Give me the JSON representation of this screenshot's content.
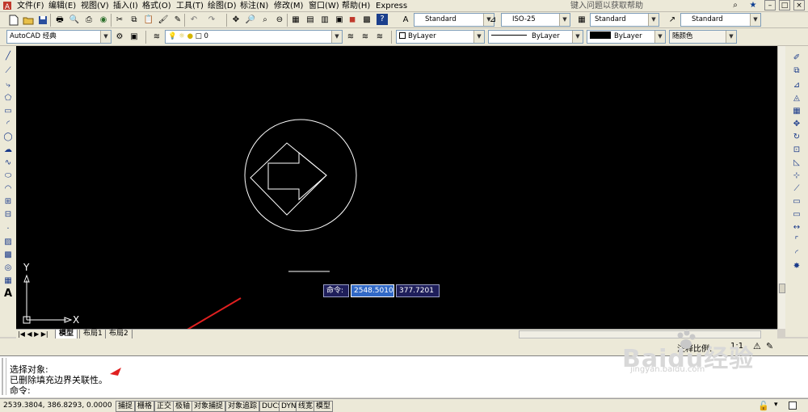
{
  "menubar": {
    "items": [
      "文件(F)",
      "编辑(E)",
      "视图(V)",
      "插入(I)",
      "格式(O)",
      "工具(T)",
      "绘图(D)",
      "标注(N)",
      "修改(M)",
      "窗口(W)",
      "帮助(H)",
      "Express"
    ],
    "help_search_placeholder": "键入问题以获取帮助"
  },
  "styles_toolbar": {
    "text_style": "Standard",
    "dim_style": "ISO-25",
    "table_style": "Standard",
    "mleader_style": "Standard"
  },
  "workspace": {
    "name": "AutoCAD 经典"
  },
  "layers": {
    "current_layer": "0"
  },
  "properties": {
    "color": "ByLayer",
    "linetype": "ByLayer",
    "lineweight": "ByLayer",
    "plot_style": "随颜色"
  },
  "canvas": {
    "ucs_y_label": "Y",
    "ucs_x_label": "X"
  },
  "dynamic_input": {
    "prompt": "命令:",
    "x_value": "2548.5010",
    "y_value": "377.7201"
  },
  "layout_tabs": [
    "模型",
    "布局1",
    "布局2"
  ],
  "annotation_scale": {
    "label": "注释比例:",
    "value": "1:1"
  },
  "command_history": [
    "选择对象:",
    "已删除填充边界关联性。",
    "命令:"
  ],
  "status": {
    "coordinates": "2539.3804, 386.8293, 0.0000",
    "toggles": [
      "捕捉",
      "栅格",
      "正交",
      "极轴",
      "对象捕捉",
      "对象追踪",
      "DUCS",
      "DYN",
      "线宽",
      "模型"
    ]
  },
  "watermark": {
    "brand": "Baidu经验",
    "url": "jingyan.baidu.com"
  },
  "colors": {
    "canvas_bg": "#000000",
    "toolbar_bg": "#ece9d8",
    "annotation_arrow": "#e02020",
    "dyn_input_bg": "#1e1e5a"
  }
}
